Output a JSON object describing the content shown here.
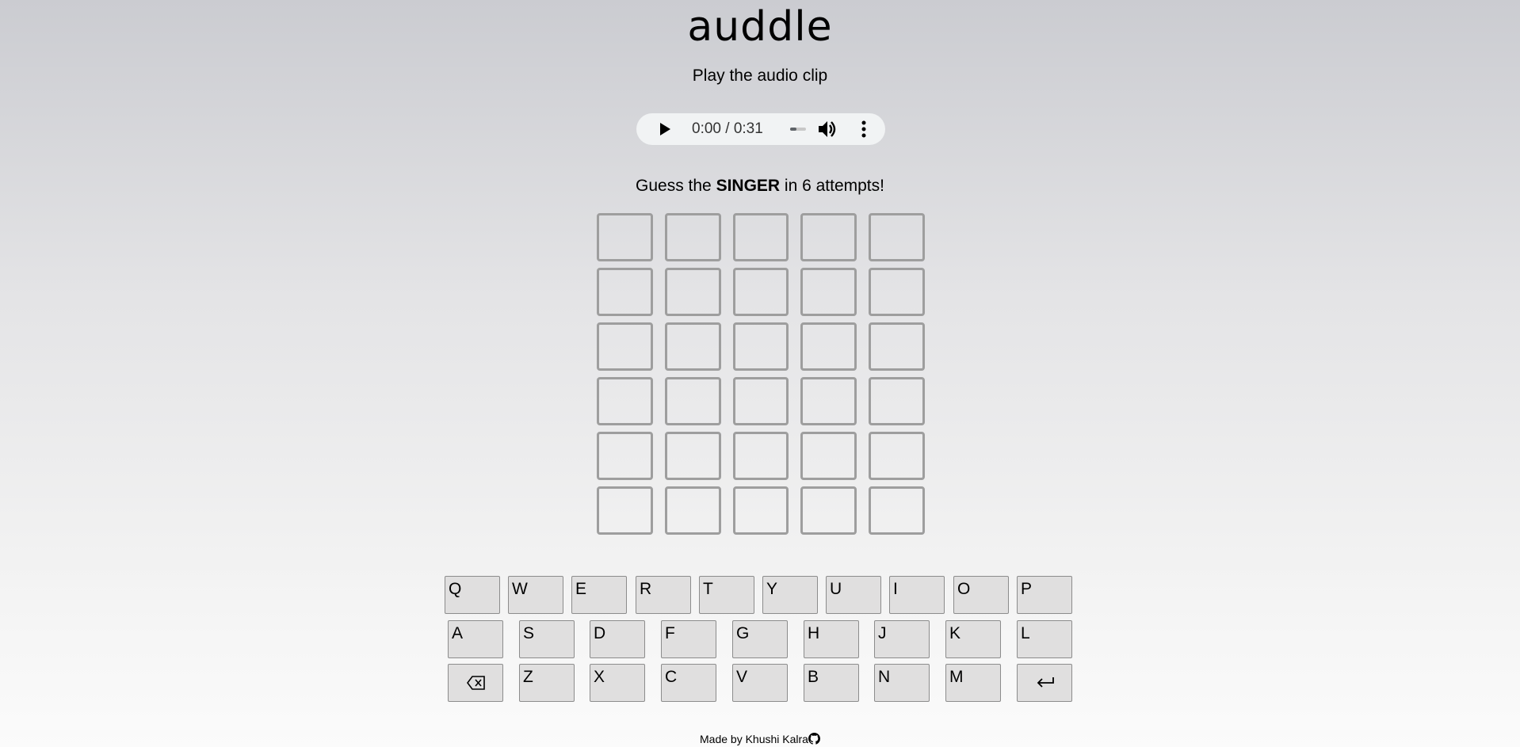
{
  "app": {
    "title": "auddle",
    "subtitle": "Play the audio clip"
  },
  "audio": {
    "time": "0:00 / 0:31",
    "progress_fraction": 0,
    "icons": [
      "play-icon",
      "volume-icon",
      "more-options-icon"
    ]
  },
  "prompt": {
    "before": "Guess the ",
    "emphasis": "SINGER",
    "after": " in 6 attempts!"
  },
  "board": {
    "rows": 6,
    "columns": 5,
    "border_color": "#9e9e9e"
  },
  "keyboard": {
    "row1": [
      "Q",
      "W",
      "E",
      "R",
      "T",
      "Y",
      "U",
      "I",
      "O",
      "P"
    ],
    "row2": [
      "A",
      "S",
      "D",
      "F",
      "G",
      "H",
      "J",
      "K",
      "L"
    ],
    "row3": [
      "backspace",
      "Z",
      "X",
      "C",
      "V",
      "B",
      "N",
      "M",
      "enter"
    ],
    "key_color": "#e0dfdf"
  },
  "footer": {
    "prefix": "Made by ",
    "author": "Khushi Kalra",
    "icon": "github-icon"
  }
}
